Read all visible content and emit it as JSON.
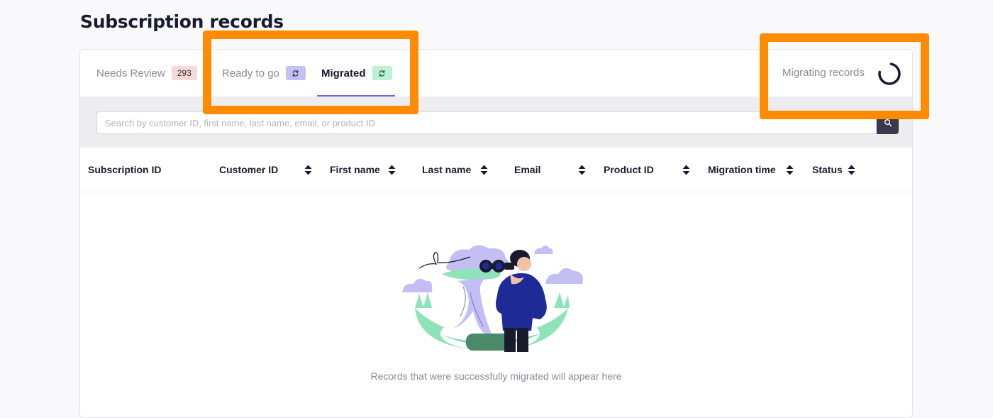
{
  "page": {
    "title": "Subscription records"
  },
  "tabs": [
    {
      "label": "Needs Review",
      "badge": "293"
    },
    {
      "label": "Ready to go",
      "badge_icon": "refresh-icon"
    },
    {
      "label": "Migrated",
      "badge_icon": "refresh-icon",
      "active": true
    }
  ],
  "status": {
    "label": "Migrating records",
    "icon": "spinner-icon"
  },
  "search": {
    "value": "",
    "placeholder": "Search by customer ID, first name, last name, email, or product ID",
    "icon": "search-icon"
  },
  "table": {
    "columns": [
      {
        "label": "Subscription ID",
        "sortable": false
      },
      {
        "label": "Customer ID",
        "sortable": true
      },
      {
        "label": "First name",
        "sortable": true
      },
      {
        "label": "Last name",
        "sortable": true
      },
      {
        "label": "Email",
        "sortable": true
      },
      {
        "label": "Product ID",
        "sortable": true
      },
      {
        "label": "Migration time",
        "sortable": true
      },
      {
        "label": "Status",
        "sortable": true
      }
    ],
    "rows": []
  },
  "empty_state": {
    "message": "Records that were successfully migrated will appear here",
    "illustration": "person-with-binoculars-illustration"
  },
  "colors": {
    "accent": "#6e6ad9",
    "highlight": "#ff8c00",
    "badge_review": "#f6d9d9",
    "badge_ready": "#c3c1f3",
    "badge_migrated": "#bdf1d4",
    "search_button": "#3a3a4e"
  }
}
